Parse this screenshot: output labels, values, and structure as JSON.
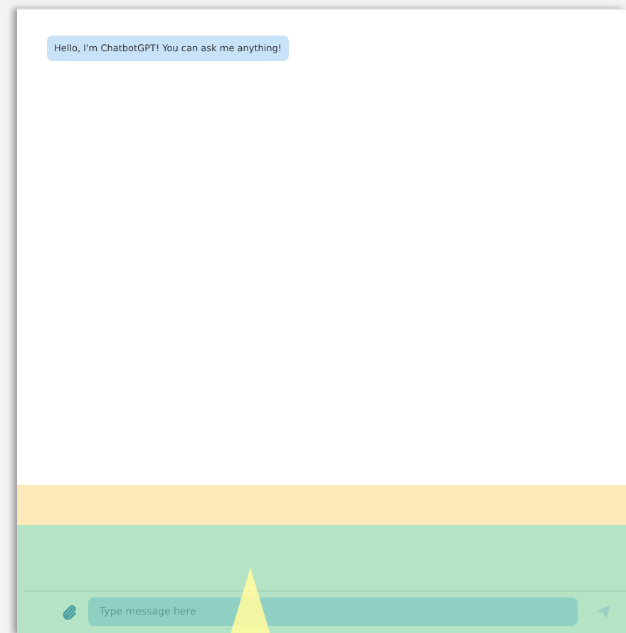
{
  "messages": [
    {
      "kind": "bot",
      "text": "Hello, I'm ChatbotGPT! You can ask me anything!"
    }
  ],
  "composer": {
    "placeholder": "Type message here"
  }
}
